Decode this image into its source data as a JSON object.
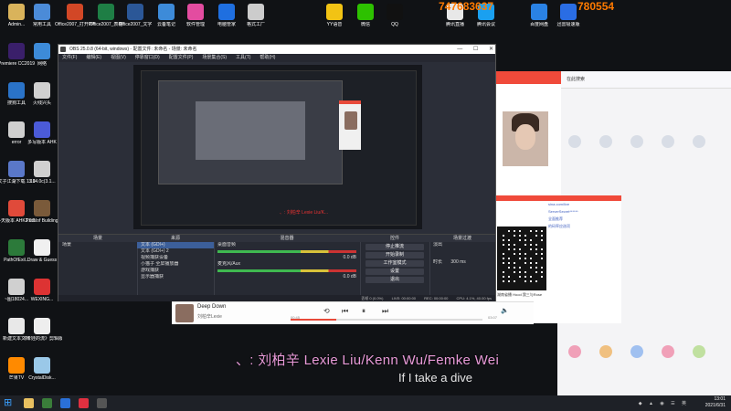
{
  "watermark": {
    "left_fragment": "747683637",
    "right_fragment": "780554"
  },
  "desktop": {
    "left_icons": [
      {
        "label": "Admin...",
        "color": "#d9b35b"
      },
      {
        "label": "Premiere CC2019",
        "color": "#3a1f6a"
      },
      {
        "label": "搜狗工具",
        "color": "#2a73c8"
      },
      {
        "label": "error",
        "color": "#cfcfcf"
      },
      {
        "label": "文子江湖下载 1.10",
        "color": "#5a78c9"
      },
      {
        "label": "多天版本 AHK2.0.19...",
        "color": "#e04a3a"
      },
      {
        "label": "PathOfExil...",
        "color": "#2c7a3a"
      },
      {
        "label": "~图18024...",
        "color": "#d0d0d0"
      },
      {
        "label": "新建文本文档",
        "color": "#e8e8e8"
      },
      {
        "label": "芒果TV",
        "color": "#ff8a00"
      }
    ],
    "col2_icons": [
      {
        "label": "常用工具",
        "color": "#4b8bd8"
      },
      {
        "label": "网络",
        "color": "#3d8bd9"
      },
      {
        "label": "火线兴头",
        "color": "#d0d0d0"
      },
      {
        "label": "多写版本 AHK",
        "color": "#4b5bd8"
      },
      {
        "label": "3.14.0c(3.1...",
        "color": "#d0d0d0"
      },
      {
        "label": "Path of Building",
        "color": "#7a5a3a"
      },
      {
        "label": "Draw & Guess",
        "color": "#f0f0f0"
      },
      {
        "label": "WEXING...",
        "color": "#d33"
      },
      {
        "label": "《卡娃的流》剪辑版",
        "color": "#eee"
      },
      {
        "label": "CrystalDisk...",
        "color": "#9ac8e8"
      }
    ],
    "top_icons": [
      {
        "label": "Office2007_打开PPT",
        "color": "#d24726"
      },
      {
        "label": "Office2007_表格",
        "color": "#1e7e45"
      },
      {
        "label": "Office2007_文字",
        "color": "#2b5797"
      },
      {
        "label": "云备笔记",
        "color": "#3d8bd9"
      },
      {
        "label": "软件管理",
        "color": "#e34ca0"
      },
      {
        "label": "电脑管家",
        "color": "#1f6fe0"
      },
      {
        "label": "格式工厂",
        "color": "#ccc"
      },
      {
        "label": "YY语音",
        "color": "#f2c314"
      },
      {
        "label": "微信",
        "color": "#2dc100"
      },
      {
        "label": "QQ",
        "color": "#111"
      },
      {
        "label": "腾讯直播",
        "color": "#e8e8e8"
      },
      {
        "label": "腾讯会议",
        "color": "#1aa0f0"
      },
      {
        "label": "百度网盘",
        "color": "#2a82e4"
      },
      {
        "label": "迅雷极速版",
        "color": "#2a6de4"
      }
    ]
  },
  "obs": {
    "title": "OBS 25.0.8 (64-bit, windows) - 配置文件: 未命名 - 场景: 未命名",
    "menu": [
      "文件(F)",
      "编辑(E)",
      "视图(V)",
      "停靠窗口(D)",
      "配置文件(P)",
      "场景集合(S)",
      "工具(T)",
      "帮助(H)"
    ],
    "preview_subtitle": "、: 刘柏辛 Lexie Liu/K...",
    "docks": {
      "scenes": {
        "header": "场景",
        "items": [
          "场景"
        ]
      },
      "sources": {
        "header": "来源",
        "items": [
          "文本 (GDI+)",
          "文本 (GDI+) 2",
          "视频捕获设备",
          "小猫子 全屏播放器",
          "游戏捕获",
          "显示器捕获"
        ]
      },
      "mixer": {
        "header": "混音器",
        "tracks": [
          {
            "name": "桌面音频",
            "db": "0.0 dB"
          },
          {
            "name": "麦克风/Aux",
            "db": "0.0 dB"
          }
        ]
      },
      "transitions": {
        "header": "场景过渡",
        "type": "淡出",
        "duration_label": "时长",
        "duration": "300 ms"
      },
      "controls": {
        "header": "控件",
        "buttons": [
          "停止推流",
          "开始录制",
          "工作室模式",
          "设置",
          "退出"
        ]
      }
    },
    "status": {
      "live": "LIVE: 00:00:00",
      "rec": "REC: 00:00:00",
      "cpu": "CPU: 4.1%, 40.00 fps",
      "frames": "丢帧 0 (0.0%)"
    }
  },
  "music": {
    "song": "Deep Down",
    "artist": "刘柏辛Lexie",
    "time_current": "00:45",
    "time_total": "03:07",
    "progress": 0.24,
    "dialog_lines": [
      "sina.com/live",
      "ServerSecret******",
      "全面推荐",
      "的码率应选项"
    ],
    "dialog_caption": "湖南省播 Hood 我三与Rose"
  },
  "subtitles": {
    "line1": "、: 刘柏辛 Lexie Liu/Kenn Wu/Femke Wei",
    "line2": "If I take a dive"
  },
  "taskbar": {
    "time": "13:01",
    "date": "2021/6/31"
  },
  "browser": {
    "tab_label": "在此搜索"
  }
}
